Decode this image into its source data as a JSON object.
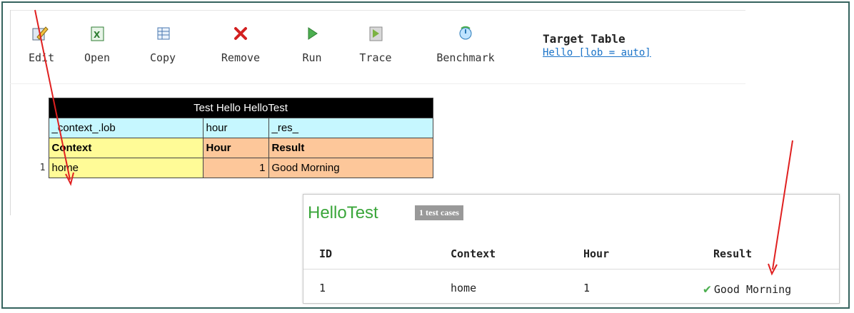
{
  "toolbar": {
    "items": [
      {
        "label": "Edit",
        "icon": "edit-icon"
      },
      {
        "label": "Open",
        "icon": "excel-open-icon"
      },
      {
        "label": "Copy",
        "icon": "copy-table-icon"
      },
      {
        "label": "Remove",
        "icon": "remove-x-icon"
      },
      {
        "label": "Run",
        "icon": "run-play-icon"
      },
      {
        "label": "Trace",
        "icon": "trace-icon"
      },
      {
        "label": "Benchmark",
        "icon": "benchmark-icon"
      }
    ],
    "target": {
      "title": "Target Table",
      "link": "Hello [lob = auto]"
    }
  },
  "test_table": {
    "title": "Test Hello HelloTest",
    "tech_headers": [
      "_context_.lob",
      "hour",
      "_res_"
    ],
    "headers": [
      "Context",
      "Hour",
      "Result"
    ],
    "rows": [
      {
        "num": "1",
        "context": "home",
        "hour": "1",
        "result": "Good Morning"
      }
    ]
  },
  "results": {
    "name": "HelloTest",
    "badge": "1 test cases",
    "columns": [
      "ID",
      "Context",
      "Hour",
      "Result"
    ],
    "rows": [
      {
        "id": "1",
        "context": "home",
        "hour": "1",
        "result": "Good Morning"
      }
    ]
  },
  "colors": {
    "border": "#35635e",
    "arrow": "#e02020",
    "pass": "#3aa63a",
    "cyan": "#c6f7ff",
    "yellow": "#fffb97",
    "orange": "#fdc79a",
    "link": "#1a73c8"
  }
}
